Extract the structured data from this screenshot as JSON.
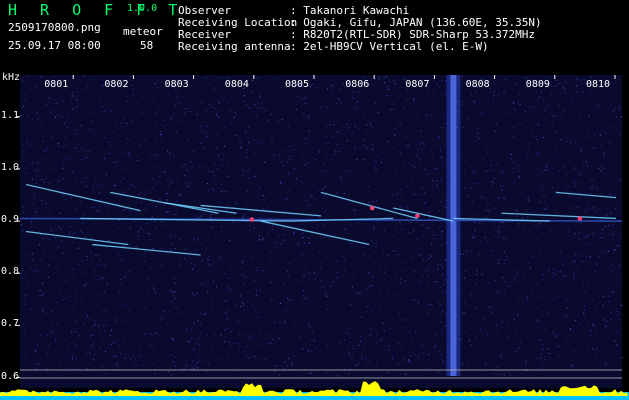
{
  "header": {
    "app_title": "H R O F F T",
    "version": "1.0.0",
    "filename": "2509170800.png",
    "datetime": "25.09.17 08:00",
    "meteor_label": "meteor",
    "meteor_count": "58",
    "fields": [
      {
        "label": "Observer",
        "value": ": Takanori Kawachi"
      },
      {
        "label": "Receiving Location",
        "value": ": Ogaki, Gifu, JAPAN (136.60E, 35.35N)"
      },
      {
        "label": "Receiver",
        "value": ": R820T2(RTL-SDR) SDR-Sharp 53.372MHz"
      },
      {
        "label": "Receiving antenna",
        "value": ": 2el-HB9CV Vertical (el. E-W)"
      }
    ]
  },
  "chart_data": {
    "type": "heatmap",
    "ylabel": "kHz",
    "yticks": [
      "1.1",
      "1.0",
      "0.9",
      "0.8",
      "0.7",
      "0.6"
    ],
    "xticks": [
      "0801",
      "0802",
      "0803",
      "0804",
      "0805",
      "0806",
      "0807",
      "0808",
      "0809",
      "0810"
    ],
    "ylim": [
      0.58,
      1.18
    ],
    "xlim_minutes": [
      0,
      10
    ],
    "colors": {
      "background": "#0a0a2e",
      "noise": "#3030a0",
      "echo": "#70d0ff",
      "hot": "#ff4070",
      "level_fill": "#ffff00",
      "level_base": "#00c0ff"
    }
  }
}
